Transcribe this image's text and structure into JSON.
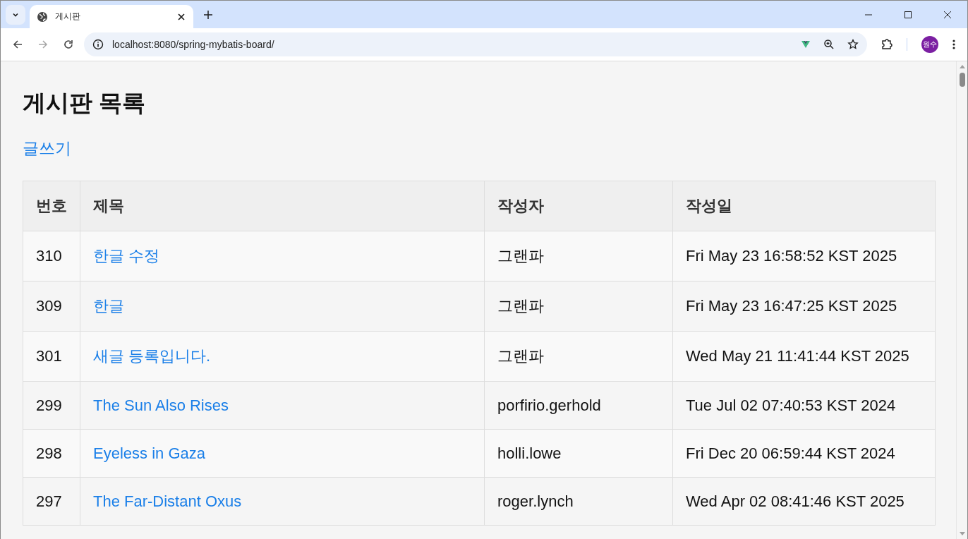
{
  "browser": {
    "tab": {
      "title": "게시판"
    },
    "address": "localhost:8080/spring-mybatis-board/",
    "profile": "원수"
  },
  "page": {
    "title": "게시판 목록",
    "write_link": "글쓰기"
  },
  "table": {
    "columns": [
      "번호",
      "제목",
      "작성자",
      "작성일"
    ],
    "rows": [
      {
        "no": "310",
        "title": "한글 수정",
        "author": "그랜파",
        "date": "Fri May 23 16:58:52 KST 2025"
      },
      {
        "no": "309",
        "title": "한글",
        "author": "그랜파",
        "date": "Fri May 23 16:47:25 KST 2025"
      },
      {
        "no": "301",
        "title": "새글 등록입니다.",
        "author": "그랜파",
        "date": "Wed May 21 11:41:44 KST 2025"
      },
      {
        "no": "299",
        "title": "The Sun Also Rises",
        "author": "porfirio.gerhold",
        "date": "Tue Jul 02 07:40:53 KST 2024"
      },
      {
        "no": "298",
        "title": "Eyeless in Gaza",
        "author": "holli.lowe",
        "date": "Fri Dec 20 06:59:44 KST 2024"
      },
      {
        "no": "297",
        "title": "The Far-Distant Oxus",
        "author": "roger.lynch",
        "date": "Wed Apr 02 08:41:46 KST 2025"
      }
    ]
  }
}
